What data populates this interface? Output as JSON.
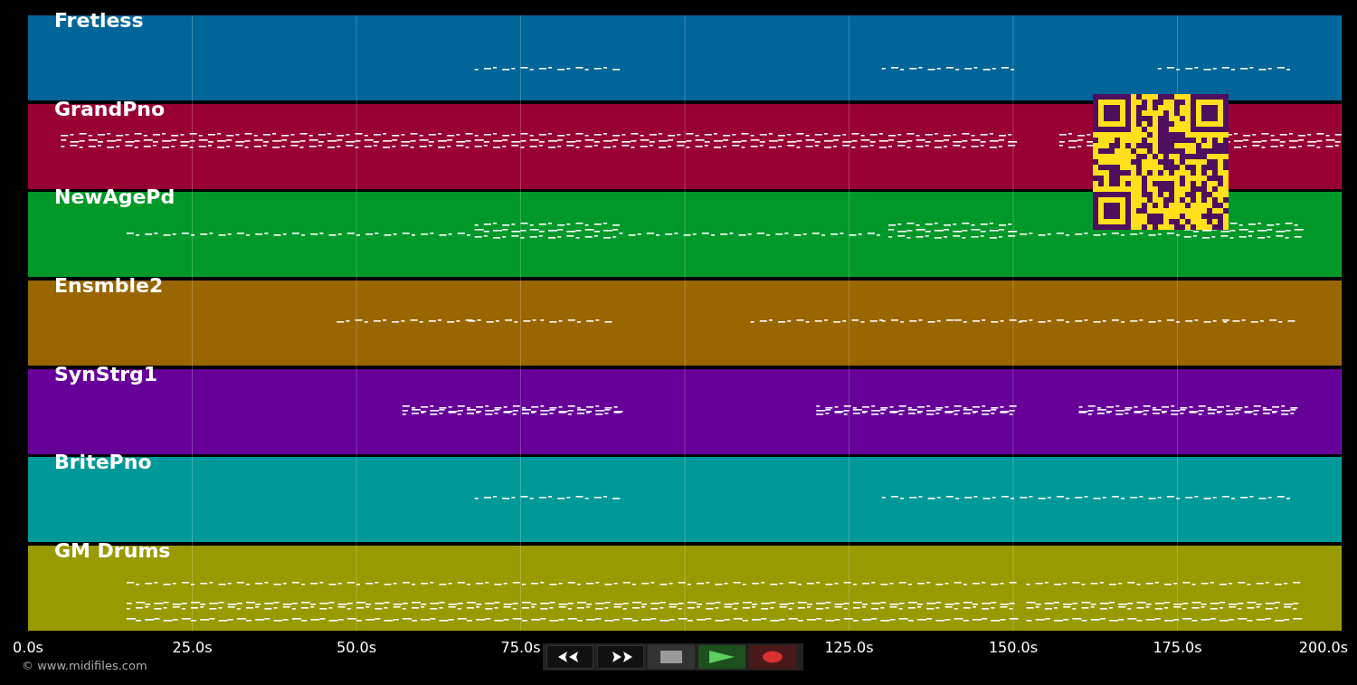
{
  "tracks": [
    {
      "name": "Fretless",
      "color": "#006699"
    },
    {
      "name": "GrandPno",
      "color": "#990033"
    },
    {
      "name": "NewAgePd",
      "color": "#009929"
    },
    {
      "name": "Ensmble2",
      "color": "#996600"
    },
    {
      "name": "SynStrg1",
      "color": "#660099"
    },
    {
      "name": "BritePno",
      "color": "#009999"
    },
    {
      "name": "GM Drums",
      "color": "#999900"
    }
  ],
  "time_axis": {
    "ticks": [
      "0.0s",
      "25.0s",
      "50.0s",
      "75.0s",
      "125.0s",
      "150.0s",
      "175.0s",
      "200.0s"
    ]
  },
  "copyright": "© www.midifiles.com"
}
